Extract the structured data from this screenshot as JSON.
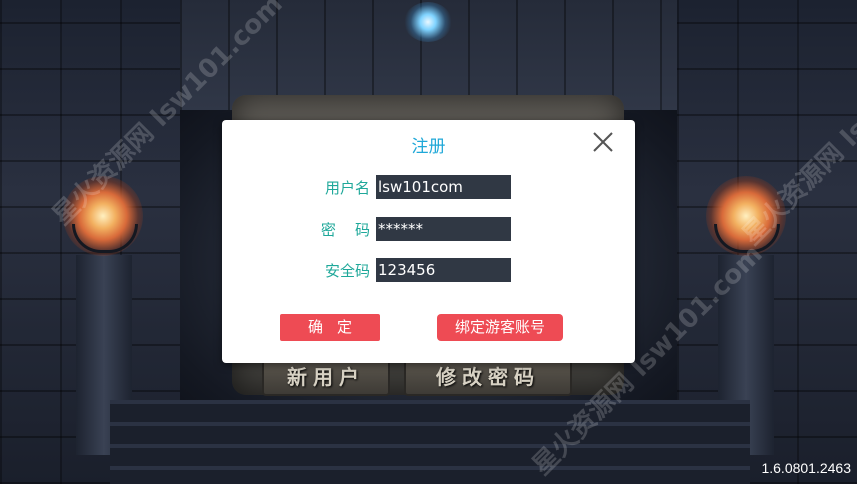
{
  "background": {
    "buttons": {
      "new_user": "新用户",
      "change_password": "修改密码"
    },
    "watermark": "星火资源网 lsw101.com"
  },
  "dialog": {
    "title": "注册",
    "close_icon": "close-x-icon",
    "fields": {
      "username": {
        "label": "用户名",
        "value": "lsw101com"
      },
      "password": {
        "label": "密    码",
        "value": "******"
      },
      "security_code": {
        "label": "安全码",
        "value": "123456"
      }
    },
    "buttons": {
      "confirm": "确定",
      "bind_guest": "绑定游客账号"
    }
  },
  "version": "1.6.0801.2463",
  "colors": {
    "title": "#1fa8d8",
    "label": "#1fa89a",
    "input_bg": "#303844",
    "button_bg": "#ee4b54"
  }
}
